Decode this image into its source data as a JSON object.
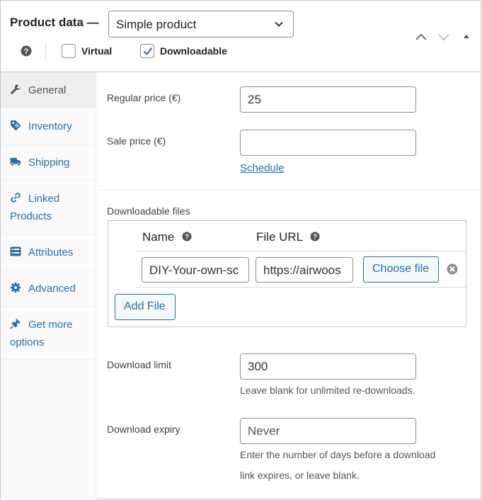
{
  "header": {
    "title": "Product data —",
    "product_type": "Simple product",
    "virtual_label": "Virtual",
    "virtual_checked": false,
    "downloadable_label": "Downloadable",
    "downloadable_checked": true
  },
  "sidebar": {
    "tabs": [
      {
        "label": "General",
        "icon": "wrench-icon",
        "active": true
      },
      {
        "label": "Inventory",
        "icon": "tag-icon",
        "active": false
      },
      {
        "label": "Shipping",
        "icon": "truck-icon",
        "active": false
      },
      {
        "label": "Linked Products",
        "icon": "link-icon",
        "active": false
      },
      {
        "label": "Attributes",
        "icon": "list-icon",
        "active": false
      },
      {
        "label": "Advanced",
        "icon": "gear-icon",
        "active": false
      },
      {
        "label": "Get more options",
        "icon": "plugin-icon",
        "active": false
      }
    ]
  },
  "general": {
    "regular_price_label": "Regular price (€)",
    "regular_price_value": "25",
    "sale_price_label": "Sale price (€)",
    "sale_price_value": "",
    "schedule_link": "Schedule",
    "downloadable_files_label": "Downloadable files",
    "files_table": {
      "col_name": "Name",
      "col_url": "File URL",
      "rows": [
        {
          "name": "DIY-Your-own-sc",
          "url": "https://airwoos"
        }
      ],
      "choose_file_label": "Choose file",
      "add_file_label": "Add File"
    },
    "download_limit_label": "Download limit",
    "download_limit_value": "300",
    "download_limit_hint": "Leave blank for unlimited re-downloads.",
    "download_expiry_label": "Download expiry",
    "download_expiry_placeholder": "Never",
    "download_expiry_hint": "Enter the number of days before a download link expires, or leave blank."
  },
  "colors": {
    "link": "#2271b1",
    "border": "#8c8f94",
    "active_tab_bg": "#eeeeee"
  }
}
